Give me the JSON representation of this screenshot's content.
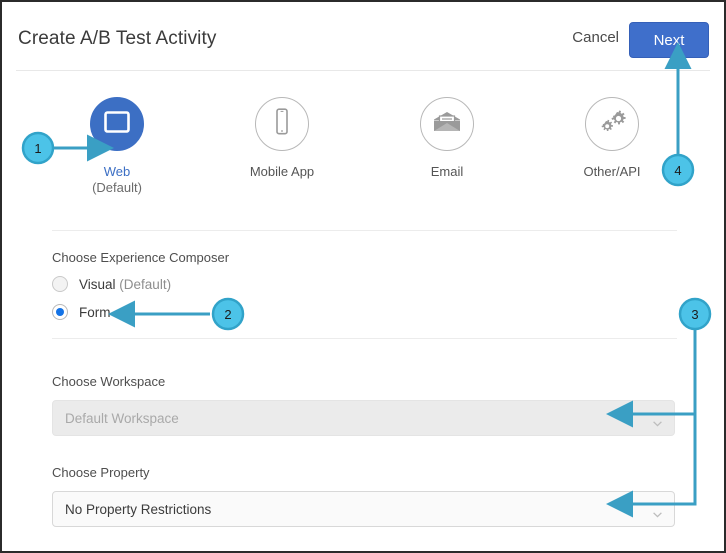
{
  "header": {
    "title": "Create A/B Test Activity",
    "cancel_label": "Cancel",
    "next_label": "Next"
  },
  "channels": [
    {
      "label": "Web",
      "sublabel": "(Default)",
      "icon": "browser-window-icon",
      "selected": true
    },
    {
      "label": "Mobile App",
      "sublabel": "",
      "icon": "mobile-phone-icon",
      "selected": false
    },
    {
      "label": "Email",
      "sublabel": "",
      "icon": "envelope-icon",
      "selected": false
    },
    {
      "label": "Other/API",
      "sublabel": "",
      "icon": "gears-icon",
      "selected": false
    }
  ],
  "composer": {
    "label": "Choose Experience Composer",
    "options": [
      {
        "label": "Visual",
        "suffix": "(Default)",
        "selected": false
      },
      {
        "label": "Form",
        "suffix": "",
        "selected": true
      }
    ]
  },
  "workspace": {
    "label": "Choose Workspace",
    "value": "Default Workspace",
    "disabled": true,
    "chevron_icon": "chevron-down-icon"
  },
  "property": {
    "label": "Choose Property",
    "value": "No Property Restrictions",
    "disabled": false,
    "chevron_icon": "chevron-down-icon"
  },
  "annotations": {
    "accent_color": "#3a9fc4",
    "badge_fill": "#4cc3e8",
    "badges": [
      {
        "number": "1",
        "target": "web-channel-option"
      },
      {
        "number": "2",
        "target": "form-radio-option"
      },
      {
        "number": "3",
        "target": "workspace-and-property-selects"
      },
      {
        "number": "4",
        "target": "next-button"
      }
    ]
  },
  "colors": {
    "primary_blue": "#3f6fcb",
    "channel_active": "#3c6fc4",
    "radio_blue": "#1473e6",
    "annotation_teal": "#3a9fc4"
  }
}
